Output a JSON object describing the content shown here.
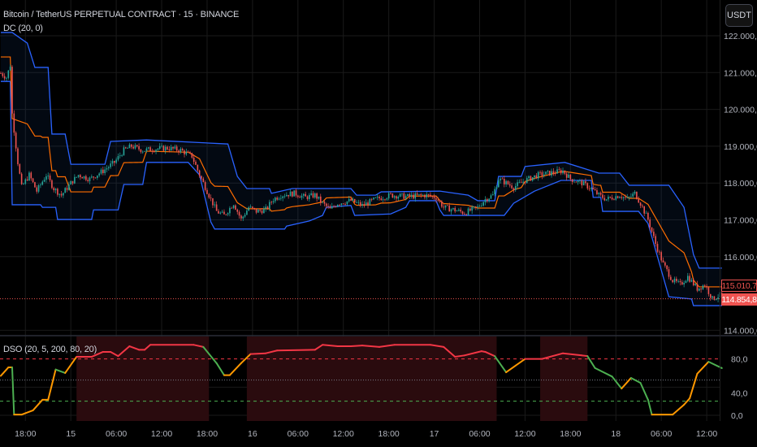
{
  "header": {
    "symbol_title": "Bitcoin / TetherUS PERPETUAL CONTRACT · 15 · BINANCE",
    "dc_legend": "DC (20, 0)",
    "dso_legend": "DSO (20, 5, 200, 80, 20)",
    "currency_button": "USDT"
  },
  "price_tags": {
    "basis_value": "115.010,7",
    "last_price": "114.854,8"
  },
  "colors": {
    "up": "#26a69a",
    "down": "#ef5350",
    "dc_band": "#2962ff",
    "dc_basis": "#ff6d00",
    "dso_overbought": "#f23645",
    "dso_rising": "#ff9800",
    "dso_falling": "#4caf50",
    "zone_fill": "#2a0b0e"
  },
  "chart_data": [
    {
      "type": "candlestick",
      "title": "Bitcoin / TetherUS PERPETUAL CONTRACT · 15 · BINANCE",
      "x_unit": "15-minute bar index",
      "ylim": [
        113800,
        122400
      ],
      "y_ticks": [
        {
          "value": 122000,
          "label": "122.000,0"
        },
        {
          "value": 121000,
          "label": "121.000,0"
        },
        {
          "value": 120000,
          "label": "120.000,0"
        },
        {
          "value": 119000,
          "label": "119.000,0"
        },
        {
          "value": 118000,
          "label": "118.000,0"
        },
        {
          "value": 117000,
          "label": "117.000,0"
        },
        {
          "value": 116000,
          "label": "116.000,0"
        },
        {
          "value": 114000,
          "label": "114.000,0"
        }
      ],
      "x_ticks": [
        {
          "bar": 13,
          "label": "18:00"
        },
        {
          "bar": 37,
          "label": "15"
        },
        {
          "bar": 61,
          "label": "06:00"
        },
        {
          "bar": 85,
          "label": "12:00"
        },
        {
          "bar": 109,
          "label": "18:00"
        },
        {
          "bar": 133,
          "label": "16"
        },
        {
          "bar": 157,
          "label": "06:00"
        },
        {
          "bar": 181,
          "label": "12:00"
        },
        {
          "bar": 205,
          "label": "18:00"
        },
        {
          "bar": 229,
          "label": "17"
        },
        {
          "bar": 253,
          "label": "06:00"
        },
        {
          "bar": 277,
          "label": "12:00"
        },
        {
          "bar": 301,
          "label": "18:00"
        },
        {
          "bar": 325,
          "label": "18"
        },
        {
          "bar": 349,
          "label": "06:00"
        },
        {
          "bar": 373,
          "label": "12:00"
        }
      ],
      "last_price": 114854.8,
      "close": [
        [
          0,
          120980
        ],
        [
          3,
          120870
        ],
        [
          5,
          121200
        ],
        [
          6,
          119880
        ],
        [
          9,
          118560
        ],
        [
          11,
          117890
        ],
        [
          15,
          118220
        ],
        [
          19,
          117780
        ],
        [
          24,
          118220
        ],
        [
          28,
          117850
        ],
        [
          32,
          117670
        ],
        [
          37,
          118000
        ],
        [
          41,
          118220
        ],
        [
          47,
          118110
        ],
        [
          54,
          118330
        ],
        [
          60,
          118560
        ],
        [
          65,
          118890
        ],
        [
          69,
          119000
        ],
        [
          75,
          118890
        ],
        [
          82,
          118930
        ],
        [
          88,
          118950
        ],
        [
          95,
          118890
        ],
        [
          101,
          118730
        ],
        [
          105,
          118220
        ],
        [
          110,
          117670
        ],
        [
          114,
          117230
        ],
        [
          118,
          117120
        ],
        [
          123,
          117450
        ],
        [
          127,
          117010
        ],
        [
          131,
          117340
        ],
        [
          135,
          117230
        ],
        [
          140,
          117280
        ],
        [
          144,
          117560
        ],
        [
          148,
          117670
        ],
        [
          155,
          117720
        ],
        [
          161,
          117610
        ],
        [
          166,
          117670
        ],
        [
          170,
          117450
        ],
        [
          174,
          117280
        ],
        [
          178,
          117450
        ],
        [
          185,
          117520
        ],
        [
          191,
          117390
        ],
        [
          198,
          117560
        ],
        [
          206,
          117670
        ],
        [
          215,
          117630
        ],
        [
          224,
          117670
        ],
        [
          230,
          117610
        ],
        [
          234,
          117340
        ],
        [
          239,
          117280
        ],
        [
          245,
          117190
        ],
        [
          252,
          117340
        ],
        [
          256,
          117560
        ],
        [
          260,
          117670
        ],
        [
          263,
          118110
        ],
        [
          267,
          118000
        ],
        [
          271,
          117890
        ],
        [
          277,
          118070
        ],
        [
          284,
          118220
        ],
        [
          290,
          118270
        ],
        [
          297,
          118330
        ],
        [
          301,
          118110
        ],
        [
          307,
          118000
        ],
        [
          312,
          117850
        ],
        [
          316,
          117670
        ],
        [
          320,
          117560
        ],
        [
          327,
          117670
        ],
        [
          331,
          117560
        ],
        [
          335,
          117720
        ],
        [
          338,
          117450
        ],
        [
          342,
          117010
        ],
        [
          346,
          116350
        ],
        [
          350,
          115800
        ],
        [
          355,
          115350
        ],
        [
          359,
          115240
        ],
        [
          363,
          115460
        ],
        [
          368,
          115130
        ],
        [
          372,
          115240
        ],
        [
          376,
          114850
        ],
        [
          381,
          114980
        ]
      ],
      "dc_upper": [
        [
          0,
          122090
        ],
        [
          6,
          122090
        ],
        [
          14,
          121800
        ],
        [
          18,
          121140
        ],
        [
          25,
          121140
        ],
        [
          27,
          119330
        ],
        [
          34,
          119330
        ],
        [
          37,
          118510
        ],
        [
          55,
          118510
        ],
        [
          58,
          119130
        ],
        [
          77,
          119170
        ],
        [
          120,
          119060
        ],
        [
          125,
          118180
        ],
        [
          130,
          117850
        ],
        [
          142,
          117850
        ],
        [
          143,
          117720
        ],
        [
          154,
          117850
        ],
        [
          185,
          117850
        ],
        [
          188,
          117670
        ],
        [
          198,
          117670
        ],
        [
          201,
          117760
        ],
        [
          232,
          117780
        ],
        [
          247,
          117670
        ],
        [
          252,
          117520
        ],
        [
          261,
          117520
        ],
        [
          263,
          118180
        ],
        [
          275,
          118180
        ],
        [
          277,
          118450
        ],
        [
          298,
          118560
        ],
        [
          316,
          118270
        ],
        [
          327,
          118270
        ],
        [
          332,
          117940
        ],
        [
          353,
          117940
        ],
        [
          361,
          117340
        ],
        [
          366,
          116060
        ],
        [
          369,
          115690
        ],
        [
          381,
          115690
        ]
      ],
      "dc_lower": [
        [
          0,
          120760
        ],
        [
          5,
          120760
        ],
        [
          6,
          117410
        ],
        [
          21,
          117410
        ],
        [
          22,
          117340
        ],
        [
          29,
          117340
        ],
        [
          30,
          117010
        ],
        [
          48,
          117010
        ],
        [
          49,
          117270
        ],
        [
          62,
          117270
        ],
        [
          65,
          117960
        ],
        [
          75,
          117960
        ],
        [
          77,
          118560
        ],
        [
          99,
          118560
        ],
        [
          105,
          118220
        ],
        [
          111,
          116940
        ],
        [
          113,
          116750
        ],
        [
          150,
          116750
        ],
        [
          151,
          116830
        ],
        [
          163,
          116970
        ],
        [
          170,
          117120
        ],
        [
          172,
          117340
        ],
        [
          185,
          117390
        ],
        [
          187,
          117120
        ],
        [
          206,
          117160
        ],
        [
          214,
          117340
        ],
        [
          216,
          117520
        ],
        [
          230,
          117520
        ],
        [
          232,
          117270
        ],
        [
          234,
          117120
        ],
        [
          266,
          117120
        ],
        [
          271,
          117450
        ],
        [
          282,
          117780
        ],
        [
          296,
          118070
        ],
        [
          312,
          118070
        ],
        [
          313,
          117610
        ],
        [
          317,
          117610
        ],
        [
          318,
          117230
        ],
        [
          337,
          117230
        ],
        [
          342,
          116900
        ],
        [
          353,
          114910
        ],
        [
          365,
          114850
        ],
        [
          366,
          114670
        ],
        [
          381,
          114670
        ]
      ]
    },
    {
      "type": "line",
      "title": "DSO (20, 5, 200, 80, 20)",
      "ylim": [
        -3,
        108
      ],
      "y_ticks": [
        {
          "value": 80,
          "label": "80,0"
        },
        {
          "value": 40,
          "label": "40,0"
        },
        {
          "value": 0,
          "label": "0,0"
        }
      ],
      "levels": {
        "overbought": 80,
        "middle": 50,
        "oversold": 20
      },
      "overbought_zones": [
        [
          40,
          110
        ],
        [
          130,
          262
        ],
        [
          285,
          310
        ]
      ],
      "values": [
        [
          0,
          56
        ],
        [
          4,
          68
        ],
        [
          6,
          68
        ],
        [
          7,
          1
        ],
        [
          11,
          1
        ],
        [
          17,
          7
        ],
        [
          22,
          22
        ],
        [
          25,
          22
        ],
        [
          29,
          65
        ],
        [
          34,
          60
        ],
        [
          40,
          83
        ],
        [
          48,
          83
        ],
        [
          54,
          90
        ],
        [
          58,
          90
        ],
        [
          62,
          84
        ],
        [
          68,
          98
        ],
        [
          73,
          93
        ],
        [
          76,
          93
        ],
        [
          79,
          100
        ],
        [
          102,
          100
        ],
        [
          107,
          97
        ],
        [
          114,
          74
        ],
        [
          118,
          57
        ],
        [
          121,
          57
        ],
        [
          127,
          74
        ],
        [
          132,
          87
        ],
        [
          140,
          88
        ],
        [
          146,
          92
        ],
        [
          166,
          93
        ],
        [
          170,
          100
        ],
        [
          178,
          98
        ],
        [
          185,
          98
        ],
        [
          191,
          99
        ],
        [
          200,
          97
        ],
        [
          208,
          100
        ],
        [
          227,
          100
        ],
        [
          234,
          97
        ],
        [
          240,
          83
        ],
        [
          245,
          85
        ],
        [
          254,
          91
        ],
        [
          256,
          90
        ],
        [
          261,
          84
        ],
        [
          267,
          61
        ],
        [
          277,
          80
        ],
        [
          286,
          80
        ],
        [
          297,
          88
        ],
        [
          307,
          85
        ],
        [
          310,
          84
        ],
        [
          314,
          67
        ],
        [
          323,
          55
        ],
        [
          328,
          38
        ],
        [
          333,
          53
        ],
        [
          338,
          46
        ],
        [
          342,
          22
        ],
        [
          344,
          1
        ],
        [
          355,
          1
        ],
        [
          361,
          15
        ],
        [
          364,
          24
        ],
        [
          368,
          59
        ],
        [
          374,
          76
        ],
        [
          381,
          67
        ]
      ]
    }
  ]
}
